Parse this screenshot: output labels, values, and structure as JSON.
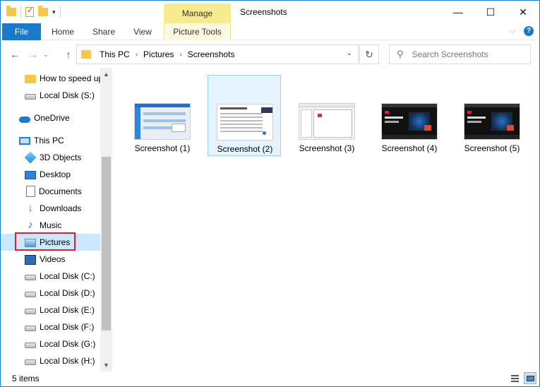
{
  "window": {
    "title": "Screenshots",
    "context_tab_group": "Manage",
    "controls": {
      "minimize": "—",
      "maximize": "☐",
      "close": "✕"
    }
  },
  "ribbon": {
    "tabs": [
      {
        "label": "File"
      },
      {
        "label": "Home"
      },
      {
        "label": "Share"
      },
      {
        "label": "View"
      },
      {
        "label": "Picture Tools"
      }
    ],
    "expand_glyph": "⌵",
    "help_glyph": "?"
  },
  "nav": {
    "back": "←",
    "forward": "→",
    "recent": "⌄",
    "up": "↑",
    "breadcrumb": [
      "This PC",
      "Pictures",
      "Screenshots"
    ],
    "crumb_sep": "›",
    "address_dropdown": "⌄",
    "refresh": "↻"
  },
  "search": {
    "placeholder": "Search Screenshots",
    "icon": "⚲"
  },
  "sidebar": {
    "items": [
      {
        "label": "How to speed up",
        "icon": "folder-icon"
      },
      {
        "label": "Local Disk (S:)",
        "icon": "drive-icon"
      },
      {
        "label": "OneDrive",
        "icon": "cloud-icon"
      },
      {
        "label": "This PC",
        "icon": "computer-icon"
      },
      {
        "label": "3D Objects",
        "icon": "3d-objects-icon"
      },
      {
        "label": "Desktop",
        "icon": "desktop-icon"
      },
      {
        "label": "Documents",
        "icon": "documents-icon"
      },
      {
        "label": "Downloads",
        "icon": "downloads-icon"
      },
      {
        "label": "Music",
        "icon": "music-icon"
      },
      {
        "label": "Pictures",
        "icon": "pictures-icon"
      },
      {
        "label": "Videos",
        "icon": "videos-icon"
      },
      {
        "label": "Local Disk (C:)",
        "icon": "drive-icon"
      },
      {
        "label": "Local Disk (D:)",
        "icon": "drive-icon"
      },
      {
        "label": "Local Disk (E:)",
        "icon": "drive-icon"
      },
      {
        "label": "Local Disk (F:)",
        "icon": "drive-icon"
      },
      {
        "label": "Local Disk (G:)",
        "icon": "drive-icon"
      },
      {
        "label": "Local Disk (H:)",
        "icon": "drive-icon"
      }
    ],
    "selected": "Pictures",
    "scroll_up": "▲",
    "scroll_down": "▼",
    "downloads_glyph": "↓",
    "music_glyph": "♪"
  },
  "files": [
    {
      "name": "Screenshot (1)"
    },
    {
      "name": "Screenshot (2)"
    },
    {
      "name": "Screenshot (3)"
    },
    {
      "name": "Screenshot (4)"
    },
    {
      "name": "Screenshot (5)"
    }
  ],
  "status": {
    "item_count": "5 items"
  },
  "colors": {
    "accent": "#1979ca",
    "manage_tab": "#f6eb8f",
    "selection": "#cce8ff",
    "highlight_box": "#e0202a"
  }
}
